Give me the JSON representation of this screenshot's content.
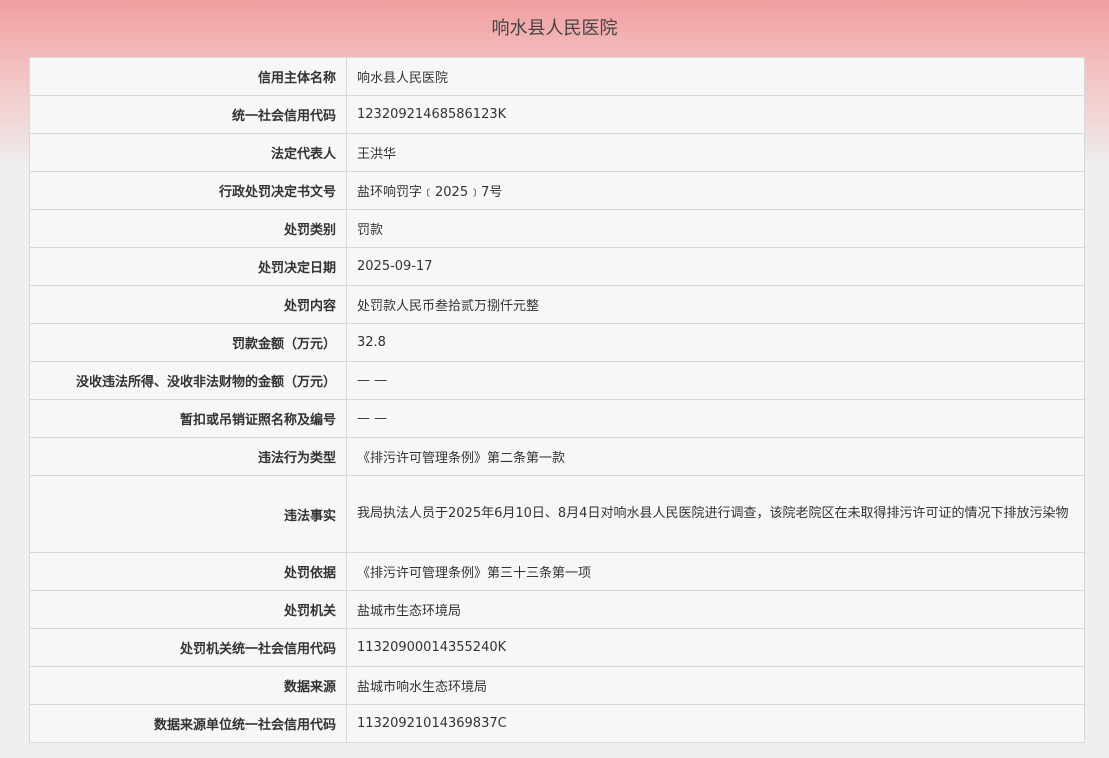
{
  "page": {
    "title": "响水县人民医院"
  },
  "rows": [
    {
      "label": "信用主体名称",
      "value": "响水县人民医院"
    },
    {
      "label": "统一社会信用代码",
      "value": "12320921468586123K"
    },
    {
      "label": "法定代表人",
      "value": "王洪华"
    },
    {
      "label": "行政处罚决定书文号",
      "value": "盐环响罚字﹝2025﹞7号"
    },
    {
      "label": "处罚类别",
      "value": "罚款"
    },
    {
      "label": "处罚决定日期",
      "value": "2025-09-17"
    },
    {
      "label": "处罚内容",
      "value": "处罚款人民币叁拾贰万捌仟元整"
    },
    {
      "label": "罚款金额（万元）",
      "value": "32.8"
    },
    {
      "label": "没收违法所得、没收非法财物的金额（万元）",
      "value": "— —"
    },
    {
      "label": "暂扣或吊销证照名称及编号",
      "value": "— —"
    },
    {
      "label": "违法行为类型",
      "value": "《排污许可管理条例》第二条第一款"
    },
    {
      "label": "违法事实",
      "value": "我局执法人员于2025年6月10日、8月4日对响水县人民医院进行调查，该院老院区在未取得排污许可证的情况下排放污染物"
    },
    {
      "label": "处罚依据",
      "value": "《排污许可管理条例》第三十三条第一项"
    },
    {
      "label": "处罚机关",
      "value": "盐城市生态环境局"
    },
    {
      "label": "处罚机关统一社会信用代码",
      "value": "11320900014355240K"
    },
    {
      "label": "数据来源",
      "value": "盐城市响水生态环境局"
    },
    {
      "label": "数据来源单位统一社会信用代码",
      "value": "11320921014369837C"
    }
  ]
}
